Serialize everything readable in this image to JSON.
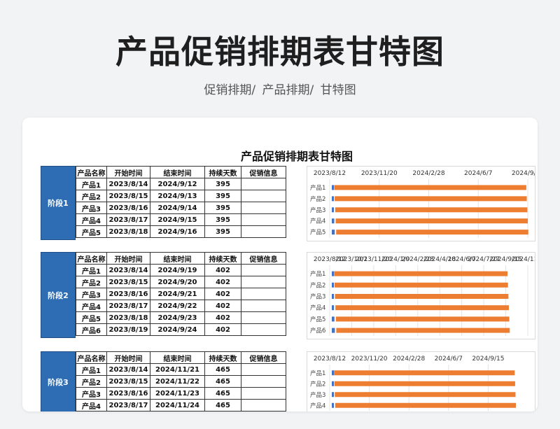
{
  "main_title": "产品促销排期表甘特图",
  "breadcrumb": [
    "促销排期/",
    "产品排期/",
    "甘特图"
  ],
  "sheet_title": "产品促销排期表甘特图",
  "headers": [
    "产品名称",
    "开始时间",
    "结束时间",
    "持续天数",
    "促销信息"
  ],
  "colors": {
    "accent": "#2e6db4",
    "bar": "#ed7d31",
    "start_bar": "#4472c4"
  },
  "phases": [
    {
      "label": "阶段1",
      "rows": [
        {
          "name": "产品1",
          "start": "2023/8/14",
          "end": "2024/9/12",
          "days": "395",
          "info": ""
        },
        {
          "name": "产品2",
          "start": "2023/8/15",
          "end": "2024/9/13",
          "days": "395",
          "info": ""
        },
        {
          "name": "产品3",
          "start": "2023/8/16",
          "end": "2024/9/14",
          "days": "395",
          "info": ""
        },
        {
          "name": "产品4",
          "start": "2023/8/17",
          "end": "2024/9/15",
          "days": "395",
          "info": ""
        },
        {
          "name": "产品5",
          "start": "2023/8/18",
          "end": "2024/9/16",
          "days": "395",
          "info": ""
        }
      ]
    },
    {
      "label": "阶段2",
      "rows": [
        {
          "name": "产品1",
          "start": "2023/8/14",
          "end": "2024/9/19",
          "days": "402",
          "info": ""
        },
        {
          "name": "产品2",
          "start": "2023/8/15",
          "end": "2024/9/20",
          "days": "402",
          "info": ""
        },
        {
          "name": "产品3",
          "start": "2023/8/16",
          "end": "2024/9/21",
          "days": "402",
          "info": ""
        },
        {
          "name": "产品4",
          "start": "2023/8/17",
          "end": "2024/9/22",
          "days": "402",
          "info": ""
        },
        {
          "name": "产品5",
          "start": "2023/8/18",
          "end": "2024/9/23",
          "days": "402",
          "info": ""
        },
        {
          "name": "产品6",
          "start": "2023/8/19",
          "end": "2024/9/24",
          "days": "402",
          "info": ""
        }
      ]
    },
    {
      "label": "阶段3",
      "rows": [
        {
          "name": "产品1",
          "start": "2023/8/14",
          "end": "2024/11/21",
          "days": "465",
          "info": ""
        },
        {
          "name": "产品2",
          "start": "2023/8/15",
          "end": "2024/11/22",
          "days": "465",
          "info": ""
        },
        {
          "name": "产品3",
          "start": "2023/8/16",
          "end": "2024/11/23",
          "days": "465",
          "info": ""
        },
        {
          "name": "产品4",
          "start": "2023/8/17",
          "end": "2024/11/24",
          "days": "465",
          "info": ""
        }
      ]
    }
  ],
  "chart_data": [
    {
      "type": "bar",
      "orientation": "horizontal-gantt",
      "categories": [
        "产品1",
        "产品2",
        "产品3",
        "产品4",
        "产品5"
      ],
      "x_ticks": [
        "2023/8/12",
        "2023/11/20",
        "2024/2/28",
        "2024/6/7",
        "2024/9/15"
      ],
      "xlim": [
        "2023/8/12",
        "2024/9/15"
      ],
      "series": [
        {
          "start": [
            "2023/8/14",
            "2023/8/15",
            "2023/8/16",
            "2023/8/17",
            "2023/8/18"
          ],
          "end": [
            "2024/9/12",
            "2024/9/13",
            "2024/9/14",
            "2024/9/15",
            "2024/9/16"
          ]
        }
      ],
      "grid": true
    },
    {
      "type": "bar",
      "orientation": "horizontal-gantt",
      "categories": [
        "产品1",
        "产品2",
        "产品3",
        "产品4",
        "产品5",
        "产品6"
      ],
      "x_ticks": [
        "2023/8/12",
        "2023/10/1",
        "2023/11/20",
        "2024/1/9",
        "2024/2/28",
        "2024/4/18",
        "2024/6/7",
        "2024/7/27",
        "2024/9/15",
        "2024/11/4"
      ],
      "xlim": [
        "2023/8/12",
        "2024/11/4"
      ],
      "series": [
        {
          "start": [
            "2023/8/14",
            "2023/8/15",
            "2023/8/16",
            "2023/8/17",
            "2023/8/18",
            "2023/8/19"
          ],
          "end": [
            "2024/9/19",
            "2024/9/20",
            "2024/9/21",
            "2024/9/22",
            "2024/9/23",
            "2024/9/24"
          ]
        }
      ],
      "grid": true
    },
    {
      "type": "bar",
      "orientation": "horizontal-gantt",
      "categories": [
        "产品1",
        "产品2",
        "产品3",
        "产品4"
      ],
      "x_ticks": [
        "2023/8/12",
        "2023/11/20",
        "2024/2/28",
        "2024/6/7",
        "2024/9/15"
      ],
      "xlim": [
        "2023/8/12",
        "2024/12/24"
      ],
      "series": [
        {
          "start": [
            "2023/8/14",
            "2023/8/15",
            "2023/8/16",
            "2023/8/17"
          ],
          "end": [
            "2024/11/21",
            "2024/11/22",
            "2024/11/23",
            "2024/11/24"
          ]
        }
      ],
      "grid": true
    }
  ]
}
